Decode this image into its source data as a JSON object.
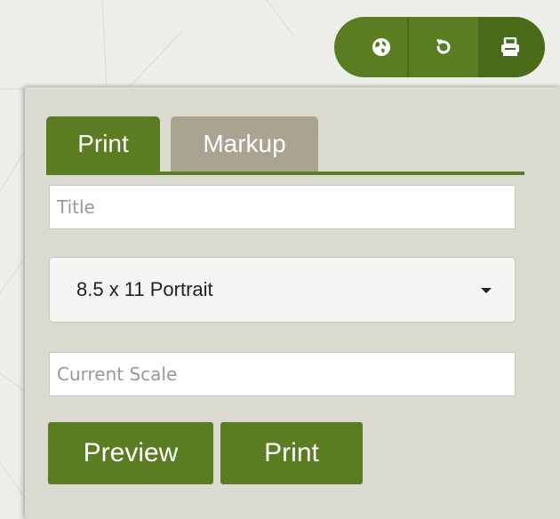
{
  "toolbar": {
    "buttons": [
      {
        "icon": "globe-icon"
      },
      {
        "icon": "refresh-icon"
      },
      {
        "icon": "printer-icon"
      }
    ]
  },
  "print_panel": {
    "tabs": [
      {
        "label": "Print",
        "active": true
      },
      {
        "label": "Markup",
        "active": false
      }
    ],
    "title_field": {
      "value": "",
      "placeholder": "Title"
    },
    "layout_select": {
      "selected": "8.5 x 11 Portrait"
    },
    "scale_field": {
      "value": "",
      "placeholder": "Current Scale"
    },
    "preview_button": "Preview",
    "print_button": "Print"
  },
  "colors": {
    "accent": "#5a7d22",
    "accent_dark": "#4a6c18",
    "tab_inactive": "#aaa392",
    "panel_bg": "#dadad0",
    "map_bg": "#eeeee8"
  }
}
